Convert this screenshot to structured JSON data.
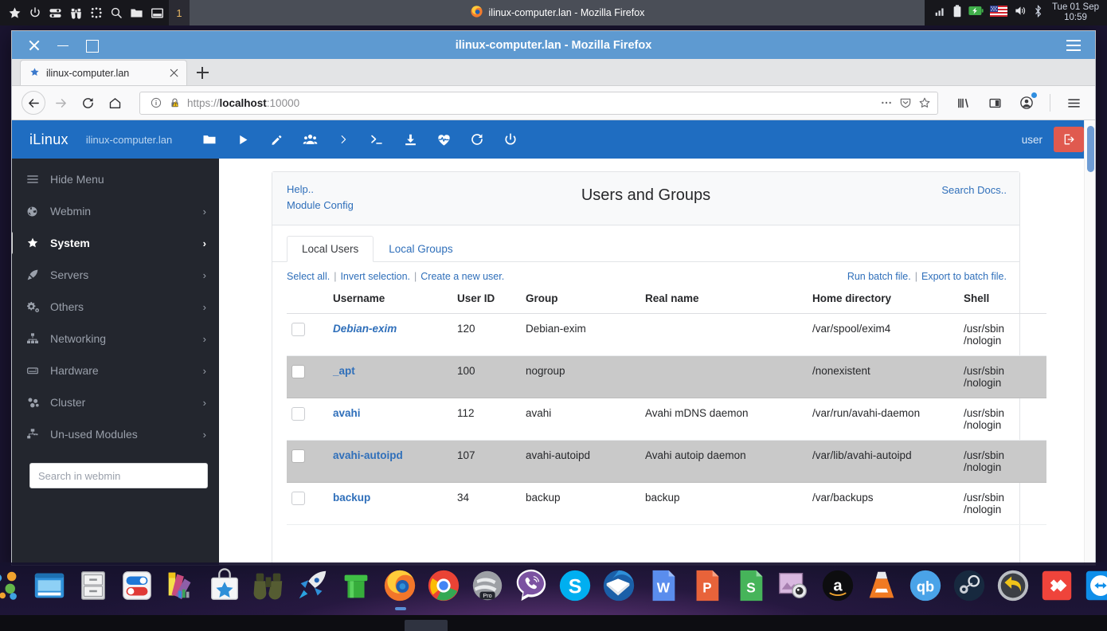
{
  "top_panel": {
    "left_icons": [
      "star-icon",
      "power-icon",
      "sliders-icon",
      "binoculars-icon",
      "apps-grid-icon",
      "search-icon",
      "folder-icon",
      "window-icon"
    ],
    "workspace": "1",
    "window_title": "ilinux-computer.lan - Mozilla Firefox",
    "window_icon": "firefox-icon",
    "tray_icons": [
      "signal-bars-icon",
      "battery-icon",
      "battery-charging-icon",
      "us-flag-icon",
      "volume-icon",
      "bluetooth-icon"
    ],
    "clock_date": "Tue 01 Sep",
    "clock_time": "10:59"
  },
  "browser": {
    "titlebar": {
      "title": "ilinux-computer.lan - Mozilla Firefox",
      "close_icon": "close-icon",
      "minimize_icon": "minimize-icon",
      "maximize_icon": "maximize-icon",
      "menu_icon": "hamburger-menu-icon"
    },
    "tab": {
      "label": "ilinux-computer.lan",
      "favicon": "star-bookmark-icon",
      "close_icon": "tab-close-icon"
    },
    "new_tab_icon": "plus-icon",
    "nav": {
      "back_icon": "back-arrow-icon",
      "forward_icon": "forward-arrow-icon",
      "reload_icon": "reload-icon",
      "home_icon": "home-icon",
      "identity_icon": "info-circle-icon",
      "security_icon": "lock-warning-icon",
      "url_scheme": "https://",
      "url_host": "localhost",
      "url_port": ":10000",
      "url_full": "https://localhost:10000",
      "page_actions_icon": "ellipsis-icon",
      "pocket_icon": "pocket-shield-icon",
      "bookmark_icon": "star-outline-icon",
      "library_icon": "library-icon",
      "sidebar_icon": "sidebar-icon",
      "account_icon": "account-icon",
      "app_menu_icon": "hamburger-menu-icon"
    }
  },
  "webmin": {
    "brand": "iLinux",
    "hostname": "ilinux-computer.lan",
    "nav_icons": [
      "folder-icon",
      "play-icon",
      "pencil-icon",
      "users-icon",
      "chevron-right-icon",
      "terminal-icon",
      "download-icon",
      "heartbeat-icon",
      "refresh-icon",
      "power-icon"
    ],
    "user_label": "user",
    "logout_icon": "logout-icon",
    "sidebar": {
      "toggle": {
        "label": "Hide Menu",
        "icon": "hamburger-menu-icon"
      },
      "items": [
        {
          "label": "Webmin",
          "icon": "globe-icon",
          "arrow": "›",
          "active": false
        },
        {
          "label": "System",
          "icon": "star-icon",
          "arrow": "›",
          "active": true
        },
        {
          "label": "Servers",
          "icon": "rocket-icon",
          "arrow": "›",
          "active": false
        },
        {
          "label": "Others",
          "icon": "gears-icon",
          "arrow": "›",
          "active": false
        },
        {
          "label": "Networking",
          "icon": "network-icon",
          "arrow": "›",
          "active": false
        },
        {
          "label": "Hardware",
          "icon": "hdd-icon",
          "arrow": "›",
          "active": false
        },
        {
          "label": "Cluster",
          "icon": "cluster-icon",
          "arrow": "›",
          "active": false
        },
        {
          "label": "Un-used Modules",
          "icon": "unused-modules-icon",
          "arrow": "›",
          "active": false
        }
      ],
      "search_placeholder": "Search in webmin",
      "search_value": ""
    },
    "page": {
      "help_link": "Help..",
      "module_config_link": "Module Config",
      "title": "Users and Groups",
      "search_docs_link": "Search Docs..",
      "tabs": [
        {
          "label": "Local Users",
          "active": true
        },
        {
          "label": "Local Groups",
          "active": false
        }
      ],
      "actions_left": [
        "Select all.",
        "Invert selection.",
        "Create a new user."
      ],
      "actions_right": [
        "Run batch file.",
        "Export to batch file."
      ],
      "columns": [
        "",
        "Username",
        "User ID",
        "Group",
        "Real name",
        "Home directory",
        "Shell"
      ],
      "rows": [
        {
          "checked": false,
          "username": "Debian-exim",
          "italic": true,
          "uid": "120",
          "group": "Debian-exim",
          "real_name": "",
          "home": "/var/spool/exim4",
          "shell": "/usr/sbin\n/nologin"
        },
        {
          "checked": false,
          "username": "_apt",
          "italic": false,
          "uid": "100",
          "group": "nogroup",
          "real_name": "",
          "home": "/nonexistent",
          "shell": "/usr/sbin\n/nologin"
        },
        {
          "checked": false,
          "username": "avahi",
          "italic": false,
          "uid": "112",
          "group": "avahi",
          "real_name": "Avahi mDNS daemon",
          "home": "/var/run/avahi-daemon",
          "shell": "/usr/sbin\n/nologin"
        },
        {
          "checked": false,
          "username": "avahi-autoipd",
          "italic": false,
          "uid": "107",
          "group": "avahi-autoipd",
          "real_name": "Avahi autoip daemon",
          "home": "/var/lib/avahi-autoipd",
          "shell": "/usr/sbin\n/nologin"
        },
        {
          "checked": false,
          "username": "backup",
          "italic": false,
          "uid": "34",
          "group": "backup",
          "real_name": "backup",
          "home": "/var/backups",
          "shell": "/usr/sbin\n/nologin"
        }
      ]
    }
  },
  "dock": {
    "items": [
      "smiley-star-icon",
      "bubbles-icon",
      "window-manager-icon",
      "file-cabinet-icon",
      "settings-toggles-icon",
      "color-palette-icon",
      "software-store-icon",
      "binoculars-icon",
      "rocket-launcher-icon",
      "green-pipe-icon",
      "firefox-icon",
      "chrome-icon",
      "opera-pro-icon",
      "viber-icon",
      "skype-icon",
      "thunderbird-icon",
      "word-processor-icon",
      "presentation-icon",
      "spreadsheet-icon",
      "photo-webcam-icon",
      "amazon-icon",
      "vlc-icon",
      "qbittorrent-icon",
      "steam-icon",
      "restore-icon",
      "anydesk-icon",
      "teamviewer-icon",
      "trash-icon"
    ],
    "running": [
      "firefox-icon"
    ]
  },
  "colors": {
    "accent_blue": "#1f6dc1",
    "link_blue": "#2f6fba",
    "sidebar_bg": "#23262e",
    "titlebar_blue": "#5e9ad1",
    "logout_red": "#e05a4f",
    "alt_row": "#c9c9c9"
  }
}
